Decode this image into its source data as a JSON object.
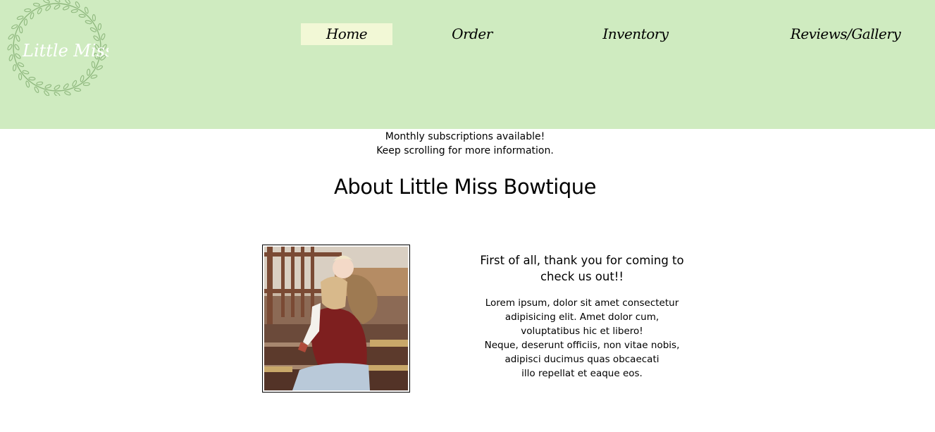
{
  "header": {
    "logo_text": "Little Miss",
    "background_color": "#cfebc0",
    "active_tab_color": "#f2f8d6"
  },
  "nav": {
    "items": [
      {
        "label": "Home",
        "active": true
      },
      {
        "label": "Order",
        "active": false
      },
      {
        "label": "Inventory",
        "active": false
      },
      {
        "label": "Reviews/Gallery",
        "active": false
      }
    ]
  },
  "announcement": {
    "line1": "Monthly subscriptions available!",
    "line2": "Keep scrolling for more information."
  },
  "about": {
    "title": "About Little Miss Bowtique",
    "heading": "First of all, thank you for coming to check us out!!",
    "body_lines": [
      "Lorem ipsum, dolor sit amet consectetur",
      "adipisicing elit. Amet dolor cum,",
      "voluptatibus hic et libero!",
      "Neque, deserunt officiis, non vitae nobis,",
      "adipisci ducimus quas obcaecati",
      "illo repellat et eaque eos."
    ]
  }
}
